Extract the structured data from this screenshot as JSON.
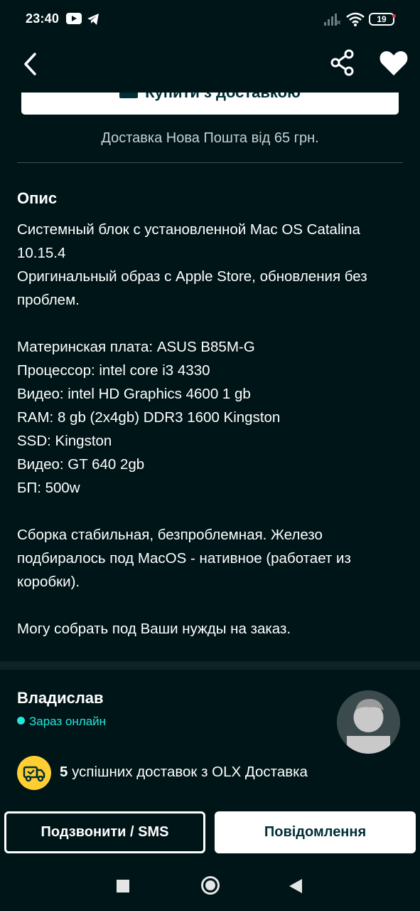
{
  "status_bar": {
    "time": "23:40",
    "battery": "19",
    "icons": [
      "youtube-icon",
      "telegram-icon",
      "signal-icon",
      "wifi-icon",
      "battery-icon"
    ]
  },
  "app_bar": {
    "back_icon": "chevron-left-icon",
    "share_icon": "share-icon",
    "favorite_icon": "heart-icon"
  },
  "purchase": {
    "buy_button_label": "Купити з доставкою",
    "delivery_note": "Доставка Нова Пошта від 65 грн."
  },
  "description": {
    "title": "Опис",
    "paragraphs": [
      "Системный блок с установленной Mac OS Catalina 10.15.4\nОригинальный образ с Apple Store, обновления без проблем.",
      "Материнская плата: ASUS B85M-G\nПроцессор: intel core i3 4330\nВидео: intel HD Graphics 4600 1 gb\nRAM: 8 gb (2x4gb) DDR3 1600 Kingston\nSSD: Kingston\nВидео: GT 640 2gb\nБП: 500w",
      "Сборка стабильная, безпроблемная. Железо подбиралось под MacOS - нативное (работает из коробки).",
      "Могу собрать под Ваши нужды на заказ."
    ]
  },
  "seller": {
    "name": "Владислав",
    "status": "Зараз онлайн",
    "deliveries_count": "5",
    "deliveries_text": " успішних доставок з OLX Доставка"
  },
  "actions": {
    "call_label": "Подзвонити / SMS",
    "message_label": "Повідомлення"
  },
  "colors": {
    "background": "#001518",
    "accent_online": "#23e5db",
    "delivery_badge": "#ffce32",
    "button_text_dark": "#002f34"
  }
}
